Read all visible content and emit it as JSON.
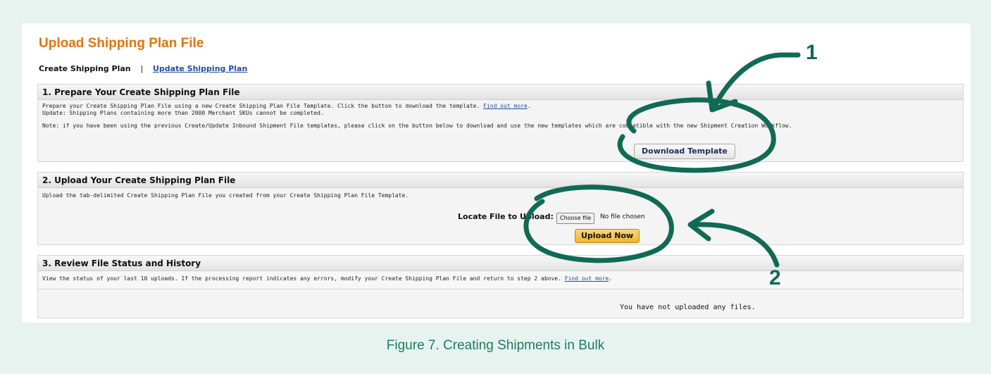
{
  "page": {
    "title": "Upload Shipping Plan File",
    "subnav": {
      "current": "Create Shipping Plan",
      "separator": "|",
      "link": "Update Shipping Plan"
    }
  },
  "section1": {
    "heading": "1. Prepare Your Create Shipping Plan File",
    "line1": "Prepare your Create Shipping Plan File using a new Create Shipping Plan File Template. Click the button to download the template.",
    "line1_link": "Find out more",
    "line2": "Update: Shipping Plans containing more than 2000 Merchant SKUs cannot be completed.",
    "note": "Note: if you have been using the previous Create/Update Inbound Shipment File templates, please click on the button below to download and use the new templates which are compatible with the new Shipment Creation Workflow.",
    "button": "Download Template"
  },
  "section2": {
    "heading": "2. Upload Your Create Shipping Plan File",
    "text": "Upload the tab-delimited Create Shipping Plan File you created from your Create Shipping Plan File Template.",
    "locate_label": "Locate File to Upload:",
    "choose_button": "Choose file",
    "no_file": "No file chosen",
    "upload_button": "Upload Now"
  },
  "section3": {
    "heading": "3. Review File Status and History",
    "text": "View the status of your last 10 uploads. If the processing report indicates any errors, modify your Create Shipping Plan File and return to step 2 above.",
    "link": "Find out more",
    "empty": "You have not uploaded any files."
  },
  "annotations": {
    "marker1": "1",
    "marker2": "2",
    "color": "#106a55"
  },
  "caption": "Figure 7. Creating Shipments in Bulk"
}
